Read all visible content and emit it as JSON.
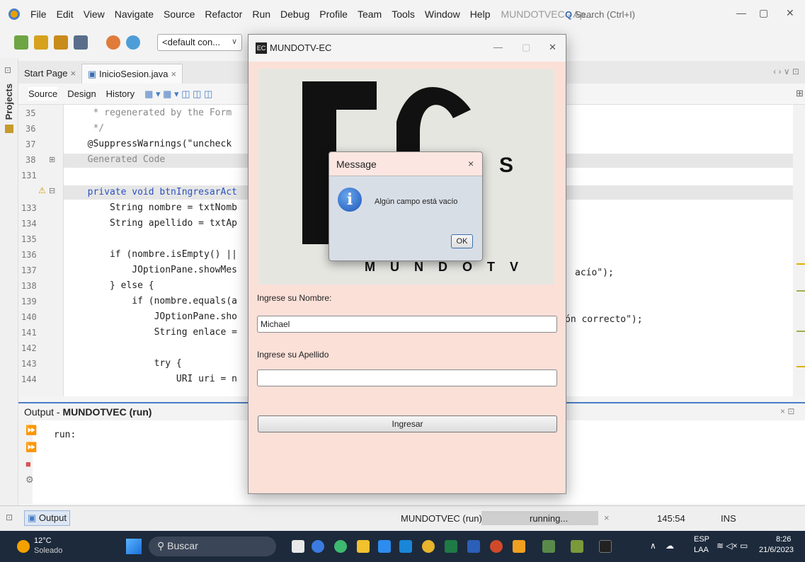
{
  "menubar": {
    "items": [
      "File",
      "Edit",
      "View",
      "Navigate",
      "Source",
      "Refactor",
      "Run",
      "Debug",
      "Profile",
      "Team",
      "Tools",
      "Window",
      "Help"
    ],
    "app_title": "MUNDOTVEC - Ap...",
    "search_placeholder": "Search (Ctrl+I)"
  },
  "toolbar": {
    "config": "<default con..."
  },
  "sidebar": {
    "projects_label": "Projects"
  },
  "tabs": [
    {
      "label": "Start Page"
    },
    {
      "label": "InicioSesion.java"
    }
  ],
  "editor_modes": [
    "Source",
    "Design",
    "History"
  ],
  "code": {
    "lines": [
      {
        "num": "35",
        "text": "   * regenerated by the Form"
      },
      {
        "num": "36",
        "text": "   */"
      },
      {
        "num": "37",
        "text": "  @SuppressWarnings(\"uncheck"
      },
      {
        "num": "38",
        "text": "  Generated Code"
      },
      {
        "num": "131",
        "text": ""
      },
      {
        "num": "",
        "text": "  private void btnIngresarAct"
      },
      {
        "num": "133",
        "text": "      String nombre = txtNomb"
      },
      {
        "num": "134",
        "text": "      String apellido = txtAp"
      },
      {
        "num": "135",
        "text": ""
      },
      {
        "num": "136",
        "text": "      if (nombre.isEmpty() ||"
      },
      {
        "num": "137",
        "text": "          JOptionPane.showMes"
      },
      {
        "num": "138",
        "text": "      } else {"
      },
      {
        "num": "139",
        "text": "          if (nombre.equals(a"
      },
      {
        "num": "140",
        "text": "              JOptionPane.sho"
      },
      {
        "num": "141",
        "text": "              String enlace ="
      },
      {
        "num": "142",
        "text": ""
      },
      {
        "num": "143",
        "text": "              try {"
      },
      {
        "num": "144",
        "text": "                  URI uri = n"
      }
    ],
    "right_fragments": {
      "line137": "acío\");",
      "line140": "ón correcto\");"
    }
  },
  "output": {
    "title_prefix": "Output - ",
    "title_bold": "MUNDOTVEC (run)",
    "text": "run:"
  },
  "statusbar": {
    "output_tab": "Output",
    "run_name": "MUNDOTVEC (run)",
    "running": "running...",
    "position": "145:54",
    "mode": "INS"
  },
  "taskbar": {
    "weather_temp": "12°C",
    "weather_desc": "Soleado",
    "search": "Buscar",
    "lang1": "ESP",
    "lang2": "LAA",
    "time": "8:26",
    "date": "21/6/2023"
  },
  "appwin": {
    "title": "MUNDOTV-EC",
    "banner_text": "M U N D O T V",
    "name_label": "Ingrese su Nombre:",
    "name_value": "Michael",
    "apellido_label": "Ingrese su Apellido",
    "apellido_value": "",
    "button": "Ingresar"
  },
  "dialog": {
    "title": "Message",
    "message": "Algún campo está vacío",
    "ok": "OK"
  },
  "colors": {
    "accent": "#4a7cc5",
    "app_bg": "#fbe0d8",
    "taskbar": "#1c2a3c"
  }
}
